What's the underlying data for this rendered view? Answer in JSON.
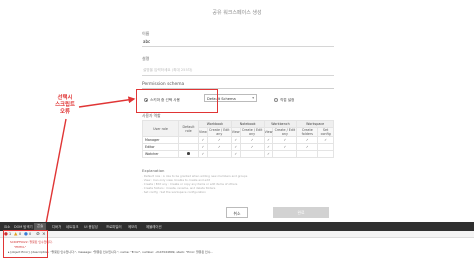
{
  "dialog": {
    "title": "공유 워크스페이스 생성",
    "name_label": "이름",
    "name_value": "abc",
    "desc_label": "설명",
    "desc_placeholder": "설명을 입력하세요 (최대 255자)",
    "permission_schema_label": "Permission schema",
    "schema_option_label": "스키마 중 선택 사용",
    "schema_select_value": "Default Schema",
    "custom_option_label": "직접 설정",
    "table_section_label": "사용자 역할",
    "cancel_label": "취소",
    "ok_label": "완료"
  },
  "perm_table": {
    "role_header": "User role",
    "default_header": "Default role",
    "groups": [
      "Workbook",
      "Notebook",
      "Workbench",
      "Workspace"
    ],
    "subheaders": [
      "View",
      "Create / Edit any",
      "View",
      "Create / Edit any",
      "View",
      "Create / Edit any",
      "Create folders",
      "Set config"
    ],
    "rows": [
      {
        "role": "Manager",
        "cells": [
          "",
          "✓",
          "✓",
          "✓",
          "✓",
          "✓",
          "✓",
          "✓",
          "✓"
        ]
      },
      {
        "role": "Editor",
        "cells": [
          "",
          "✓",
          "✓",
          "✓",
          "✓",
          "✓",
          "✓",
          "✓",
          ""
        ]
      },
      {
        "role": "Watcher",
        "cells": [
          "●",
          "✓",
          "",
          "✓",
          "",
          "✓",
          "",
          "",
          ""
        ]
      }
    ]
  },
  "explanation": {
    "title": "Explanation",
    "lines": [
      "· Default role : A role to be granted when adding new members and groups",
      "· View : Can only view. Unable to create and edit",
      "· Create / Edit any : Create or copy any items or edit items of others",
      "· Create folders : Create, rename, and delete folders",
      "· Set config : Set the workspace configuration"
    ]
  },
  "annotation": {
    "lines": [
      "선택시",
      "스크립트",
      "오류"
    ]
  },
  "devtools": {
    "tabs": [
      "요소",
      "DOM 탐색기",
      "콘솔",
      "디버거",
      "네트워크",
      "UI 응답성",
      "프로파일러",
      "메모리",
      "에뮬레이션"
    ],
    "active_tab_index": 2,
    "error_count": "1",
    "warning_count": "0",
    "info_count": "0",
    "console_line1": "SCRIPT5022: 잘못된 인수입니다.",
    "console_line2": "\"EMTCL\"",
    "console_line3": "▸ [object Error] {description: \"잘못된 인수입니다.\", message: \"잘못된 인수입니다.\", name: \"Error\", number: -2147024809, stack: \"Error: 잘못된 인수..."
  },
  "colors": {
    "annotation_red": "#e03535",
    "devtools_bg": "#2f2f2f",
    "error_red": "#d03030"
  }
}
